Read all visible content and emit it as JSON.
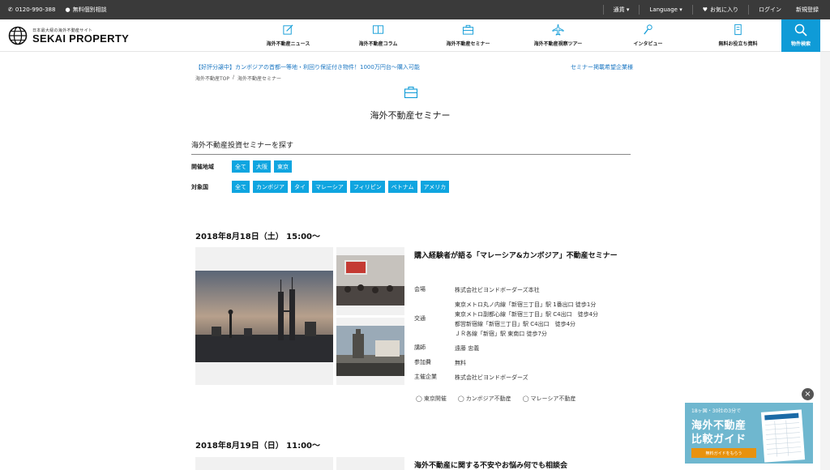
{
  "topbar": {
    "phone": "0120-990-388",
    "consult": "無料個別相談",
    "currency": "通貨 ▾",
    "language": "Language ▾",
    "favorites": "お気に入り",
    "login": "ログイン",
    "register": "新規登録"
  },
  "logo": {
    "tagline": "日本最大級の海外不動産サイト",
    "name": "SEKAI PROPERTY"
  },
  "nav": [
    {
      "label": "海外不動産ニュース",
      "icon": "pencil-icon"
    },
    {
      "label": "海外不動産コラム",
      "icon": "book-icon"
    },
    {
      "label": "海外不動産セミナー",
      "icon": "briefcase-icon"
    },
    {
      "label": "海外不動産視察ツアー",
      "icon": "airplane-icon"
    },
    {
      "label": "インタビュー",
      "icon": "microphone-icon"
    },
    {
      "label": "無料お役立ち資料",
      "icon": "document-icon"
    }
  ],
  "search": {
    "label": "物件検索"
  },
  "notice": {
    "left": "【好評分譲中】カンボジアの首都一等地・利回り保証付き物件！1000万円台〜購入可能",
    "right": "セミナー掲載希望企業様"
  },
  "breadcrumb": [
    "海外不動産TOP",
    "/",
    "海外不動産セミナー"
  ],
  "page_title": "海外不動産セミナー",
  "section_head": "海外不動産投資セミナーを探す",
  "filters": {
    "region": {
      "label": "開催地域",
      "options": [
        "全て",
        "大阪",
        "東京"
      ]
    },
    "country": {
      "label": "対象国",
      "options": [
        "全て",
        "カンボジア",
        "タイ",
        "マレーシア",
        "フィリピン",
        "ベトナム",
        "アメリカ"
      ]
    }
  },
  "events": [
    {
      "date": "2018年8月18日（土） 15:00〜",
      "title": "購入経験者が語る「マレーシア&カンボジア」不動産セミナー",
      "venue_label": "会場",
      "venue": "株式会社ビヨンドボーダーズ本社",
      "access_label": "交通",
      "access": [
        "東京メトロ丸ノ内線「新宿三丁目」駅 1番出口 徒歩1分",
        "東京メトロ副都心線「新宿三丁目」駅 C4出口　徒歩4分",
        "都営新宿線「新宿三丁目」駅 C4出口　徒歩4分",
        "ＪＲ各線「新宿」駅 東南口 徒歩7分"
      ],
      "speaker_label": "講師",
      "speaker": "遠藤 忠義",
      "fee_label": "参加費",
      "fee": "無料",
      "host_label": "主催企業",
      "host": "株式会社ビヨンドボーダーズ",
      "tags": [
        "東京開催",
        "カンボジア不動産",
        "マレーシア不動産"
      ]
    },
    {
      "date": "2018年8月19日（日） 11:00〜",
      "title": "海外不動産に関する不安やお悩み何でも相談会"
    }
  ],
  "banner": {
    "small": "18ヶ国・30社の3分で",
    "line1": "海外不動産",
    "line2": "比較ガイド",
    "cta": "無料ガイドをもらう"
  },
  "colors": {
    "accent": "#0fa5e0",
    "topbar": "#3a3a3a",
    "link": "#1976c2",
    "cta": "#e8920e"
  }
}
